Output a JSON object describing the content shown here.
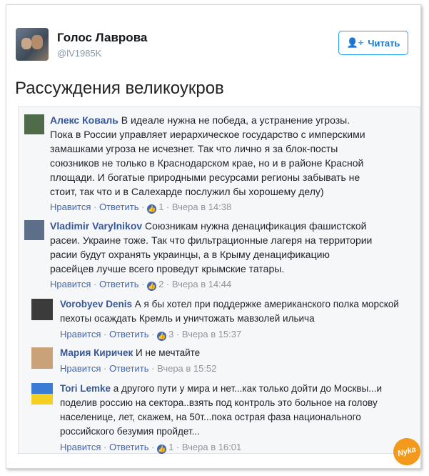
{
  "tweet": {
    "name": "Голос Лаврова",
    "handle": "@lV1985K",
    "follow_label": "Читать",
    "text": "Рассуждения великоукров"
  },
  "comments": [
    {
      "author": "Алекс Коваль",
      "lines": [
        " В идеале нужна не победа, а устранение угрозы.",
        "Пока в России управляет иерархическое государство с имперскими",
        "замашками угроза не исчезнет. Так что лично я за блок-посты",
        "союзников не только в Краснодарском крае, но и в районе Красной",
        "площади. И богатые природными ресурсами регионы забывать не",
        "стоит, так что и в Салехарде послужил бы хорошему делу)"
      ],
      "like": "Нравится",
      "reply": "Ответить",
      "likes": "1",
      "time": "Вчера в 14:38"
    },
    {
      "author": "Vladimir Varylnikov",
      "lines": [
        " Союзникам нужна денацификация фашистской",
        "расеи. Украине тоже. Так что фильтрационные лагеря на территории",
        "расии будут охранять украинцы, а в Крыму денацификацию",
        "расейцев лучше всего проведут крымские татары."
      ],
      "like": "Нравится",
      "reply": "Ответить",
      "likes": "2",
      "time": "Вчера в 14:44"
    },
    {
      "author": "Vorobyev Denis",
      "lines": [
        " А я бы хотел при поддержке американского полка морской",
        "пехоты осаждать Кремль и уничтожать мавзолей ильича"
      ],
      "like": "Нравится",
      "reply": "Ответить",
      "likes": "3",
      "time": "Вчера в 15:37"
    },
    {
      "author": "Мария Киричек",
      "lines": [
        " И не мечтайте"
      ],
      "like": "Нравится",
      "reply": "Ответить",
      "time": "Вчера в 15:52"
    },
    {
      "author": "Tori Lemke",
      "lines": [
        " а другого пути у мира и нет...как только дойти до Москвы...и",
        "поделив россию на сектора..взять под контроль это больное на голову",
        "населенице, лет, скажем, на 50т...пока острая фаза национального",
        "российского безумия пройдет..."
      ],
      "like": "Нравится",
      "reply": "Ответить",
      "likes": "1",
      "time": "Вчера в 16:01"
    }
  ],
  "watermark": "Nyka",
  "colors": {
    "link": "#365899",
    "meta": "#90949c",
    "twitter_blue": "#1da1f2",
    "watermark": "#f39a1c"
  }
}
